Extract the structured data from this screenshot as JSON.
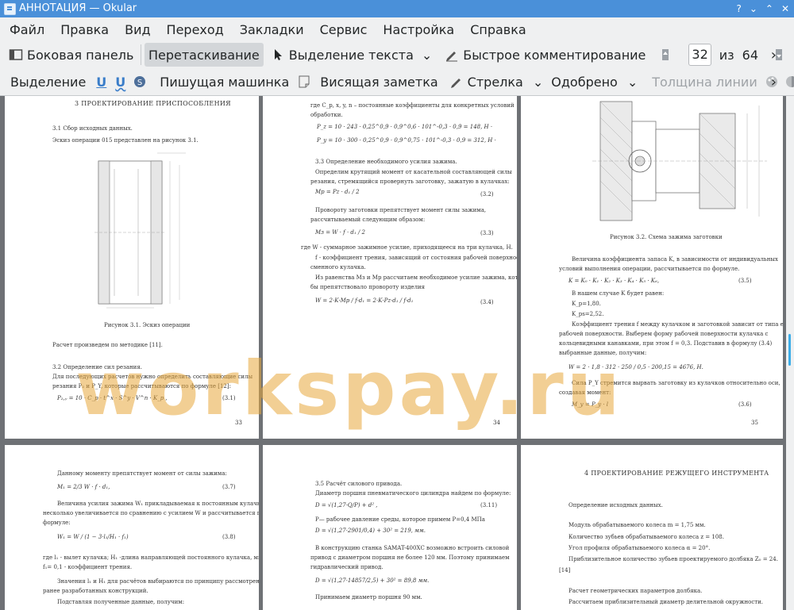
{
  "window": {
    "title": "АННОТАЦИЯ  — Okular"
  },
  "menu": [
    "Файл",
    "Правка",
    "Вид",
    "Переход",
    "Закладки",
    "Сервис",
    "Настройка",
    "Справка"
  ],
  "toolbar1": {
    "sidebar": "Боковая панель",
    "drag": "Перетаскивание",
    "text_select": "Выделение текста",
    "quick_annot": "Быстрое комментирование",
    "page_current": "32",
    "page_of": "из",
    "page_total": "64",
    "more": "›"
  },
  "toolbar2": {
    "highlight": "Выделение",
    "typewriter": "Пишущая машинка",
    "note": "Висящая заметка",
    "arrow": "Стрелка",
    "stamp": "Одобрено",
    "line_width": "Толщина линии",
    "more": "›"
  },
  "watermark": "workspay.ru",
  "pages": {
    "p33": {
      "heading": "3  ПРОЕКТИРОВАНИЕ ПРИСПОСОБЛЕНИЯ",
      "l1": "3.1 Сбор исходных данных.",
      "l2": "Эскиз операции 015 представлен на рисунок 3.1.",
      "caption": "Рисунок 3.1. Эскиз операции",
      "l3": "Расчет произведем по методике [11].",
      "l4": "3.2 Определение сил резания.",
      "l5": "Для последующих расчетов нужно определить составляющие силы",
      "l6": "резания P₂ и P_Y, которые рассчитываются по формуле [12]:",
      "f1": "P₂,ᵧ = 10 · C_p · t^x · S^y · V^n · K_p ,",
      "f1n": "(3.1)",
      "num": "33"
    },
    "p34": {
      "l1": "где C_p, x, y, n – постоянные коэффициенты для конкретных условий",
      "l2": "обработки.",
      "f1": "P_z = 10 · 243 · 0,25^0,9 · 0,9^0,6 · 101^-0,3 · 0,9 = 148, Н ·",
      "f2": "P_y = 10 · 300 · 0,25^0,9 · 0,9^0,75 · 101^-0,3 · 0,9 = 312, Н ·",
      "l3": "3.3 Определение необходимого усилия зажима.",
      "l4": "Определим крутящий момент от касательной составляющей силы",
      "l5": "резания, стремящийся провернуть заготовку, зажатую в кулачках:",
      "f3n": "(3.2)",
      "l6": "Провороту заготовки препятствует момент силы зажима,",
      "l7": "рассчитываемый следующим образом:",
      "f4n": "(3.3)",
      "l8": "где W - суммарное зажимное усилие, приходящееся на три кулачка, Н.",
      "l9": "f - коэффициент трения, зависящий от состояния рабочей поверхности",
      "l10": "сменного кулачка.",
      "l11": "Из равенства Mз и Mр рассчитаем необходимое усилие зажима, которое",
      "l12": "бы препятствовало провороту изделия",
      "f5n": "(3.4)",
      "num": "34"
    },
    "p35": {
      "caption": "Рисунок 3.2. Схема зажима заготовки",
      "l1": "Величина коэффициента запаса K, в зависимости от индивидуальных",
      "l2": "условий выполнения операции, рассчитывается по формуле.",
      "f1": "K = K₀ · K₁ · K₂ · K₃ · K₄ · K₅ · K₆,",
      "f1n": "(3.5)",
      "l3": "В нашем случае K будет равен:",
      "l4": "K_p=1,80.",
      "l5": "K_ps=2,52.",
      "l6": "Коэффициент трения f между кулачком и заготовкой зависит от типа его",
      "l7": "рабочей поверхности. Выберем форму рабочей поверхности кулачка с",
      "l8": "кольцевидными канавками, при этом  f = 0,3.  Подставив в формулу (3.4)",
      "l9": "выбранные данные, получим:",
      "f2": "W = 2 · 1,8 · 312 · 250 / 0,5 · 200,15 = 4676, Н.",
      "l10": "Сила P_Y стремится вырвать заготовку из кулачков относительно оси,",
      "l11": "создавая момент:",
      "f3": "M_y = P_y · l",
      "f3n": "(3.6)",
      "num": "35"
    },
    "p36": {
      "l1": "Данному моменту препятствует момент от силы зажима:",
      "f1": "M₁ = 2/3 W · f · d₁,",
      "f1n": "(3.7)",
      "l2": "Величина усилия зажима W₁ прикладываемая к постоянным кулачкам",
      "l3": "несколько увеличивается по сравнению с усилием W и рассчитывается по",
      "l4": "формуле:",
      "f2n": "(3.8)",
      "l5": "где l₁ -  вылет кулачка; H₁ -длина направляющей постоянного кулачка, мм;",
      "l6": "f₁= 0,1 - коэффициент трения.",
      "l7": "Значения l₁ и H₁ для расчётов выбираются по принципу рассмотрения",
      "l8": "ранее разработанных конструкций.",
      "l9": "Подставляя полученные данные, получим:"
    },
    "p37": {
      "l1": "3.5 Расчёт силового привода.",
      "l2": "Диаметр поршня пневматического цилиндра найдем по формуле:",
      "f1n": "(3.11)",
      "l3": "P— рабочее давление среды, которое примем P=0,4 МПа",
      "f2": "D = √(1,27·2901/0,4) + 30² = 219, мм.",
      "l4": "В конструкцию станка SAMAT-400ХС возможно встроить силовой",
      "l5": "привод с диаметром поршня не более 120 мм. Поэтому принимаем",
      "l6": "гидравлический привод.",
      "f3": "D = √(1,27·14857/2,5) + 30² = 89,8 мм.",
      "l7": "Принимаем диаметр поршня 90 мм."
    },
    "p38": {
      "heading": "4  ПРОЕКТИРОВАНИЕ РЕЖУЩЕГО ИНСТРУМЕНТА",
      "l1": "Определение исходных данных.",
      "l2": "Модуль обрабатываемого колеса  m = 1,75 мм.",
      "l3": "Количество зубьев обрабатываемого колеса  z = 108.",
      "l4": "Угол профиля обрабатываемого колеса  α = 20°.",
      "l5": "Приблизительное количество зубьев проектируемого долбяка  Z₀ = 24.",
      "l6": "[14]",
      "l7": "Расчет геометрических параметров долбяка.",
      "l8": "Рассчитаем приблизительный диаметр делительной окружности."
    }
  }
}
